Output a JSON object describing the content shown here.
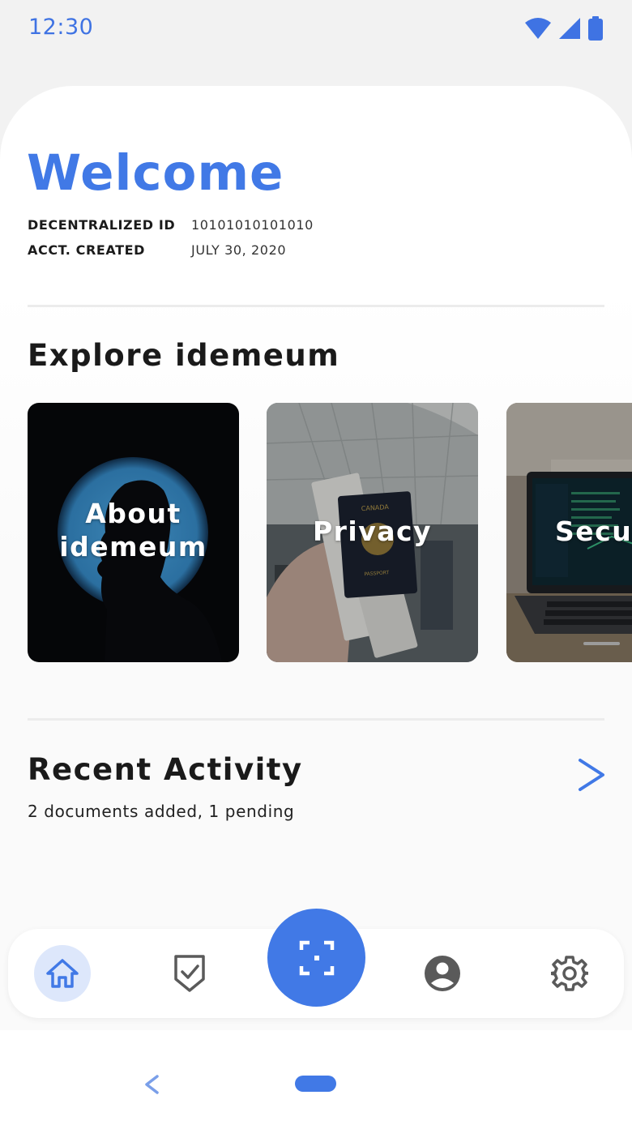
{
  "status": {
    "time": "12:30"
  },
  "header": {
    "title": "Welcome"
  },
  "account": {
    "id_label": "DECENTRALIZED ID",
    "id_value": "10101010101010",
    "created_label": "ACCT. CREATED",
    "created_value": "JULY 30, 2020"
  },
  "explore": {
    "title": "Explore idemeum",
    "cards": [
      {
        "line1": "About",
        "line2": "idemeum"
      },
      {
        "line1": "Privacy"
      },
      {
        "line1": "Security"
      }
    ]
  },
  "activity": {
    "title": "Recent Activity",
    "subtitle": "2 documents added, 1 pending"
  },
  "nav": {
    "items": [
      "home-icon",
      "shield-check-icon",
      "scan-icon",
      "profile-icon",
      "settings-icon"
    ],
    "active": "home-icon"
  },
  "colors": {
    "accent": "#4179e6",
    "accent_light": "#dde7fb",
    "icon_gray": "#5a5a5a"
  }
}
